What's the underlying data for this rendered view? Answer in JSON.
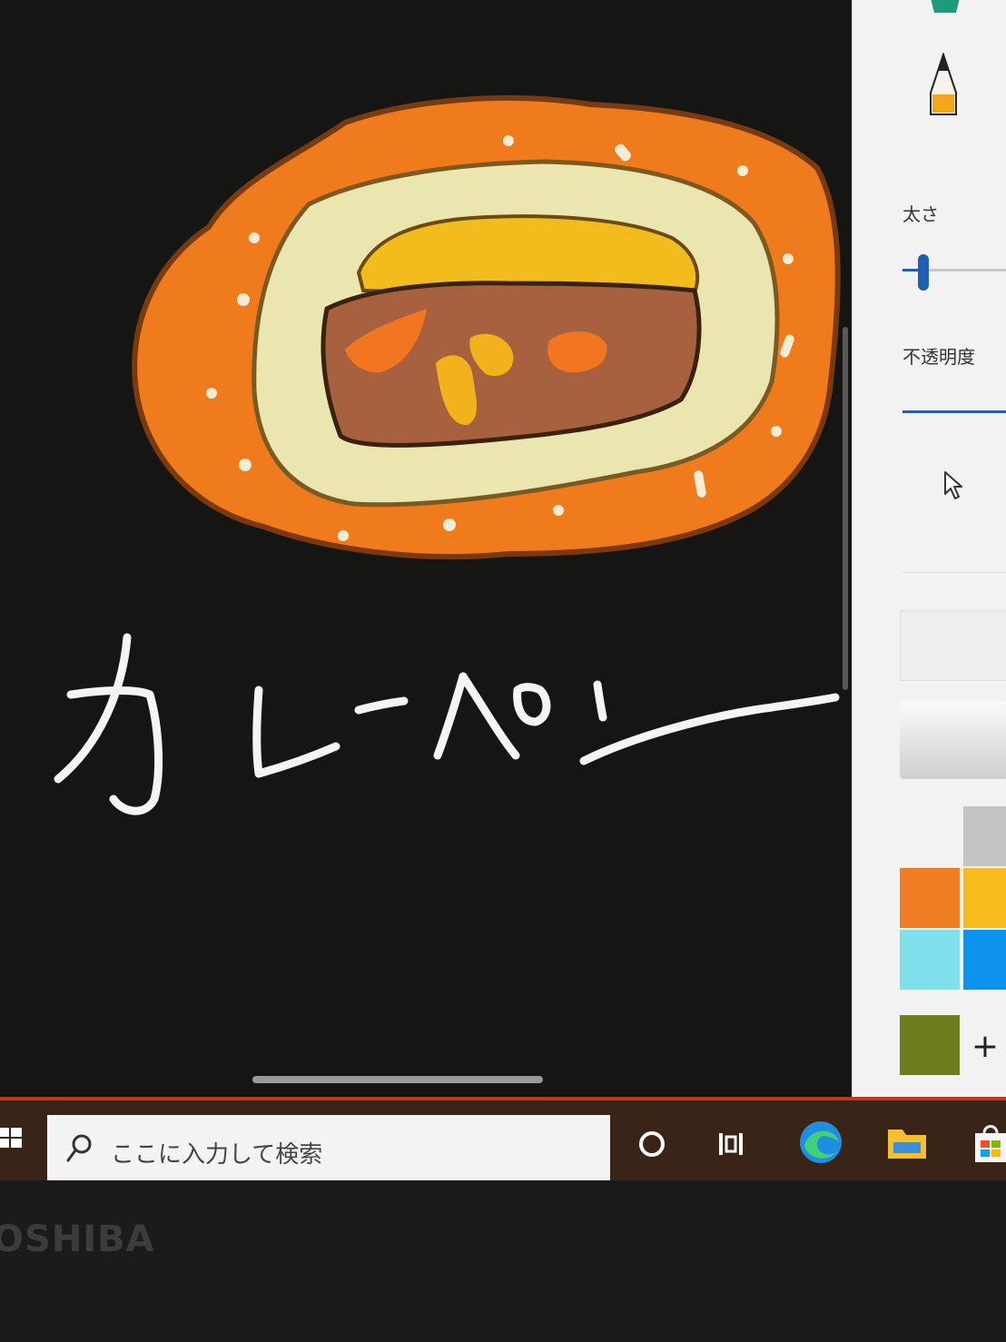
{
  "panel": {
    "thickness_label": "太さ",
    "opacity_label": "不透明度",
    "thickness_value": 0.2,
    "opacity_value": 1.0,
    "add_color_label": "+"
  },
  "palette": [
    {
      "name": "white",
      "color": "#f2f2f2"
    },
    {
      "name": "light-gray",
      "color": "#c4c4c4"
    },
    {
      "name": "orange",
      "color": "#f07d22"
    },
    {
      "name": "yellow",
      "color": "#f6bc1e"
    },
    {
      "name": "light-cyan",
      "color": "#80e0ec"
    },
    {
      "name": "blue",
      "color": "#0b93ee"
    },
    {
      "name": "olive",
      "color": "#6e7c1d"
    }
  ],
  "taskbar": {
    "search_placeholder": "ここに入力して検索",
    "accent_color": "#c0361b"
  },
  "bezel": {
    "brand": "OSHIBA"
  }
}
